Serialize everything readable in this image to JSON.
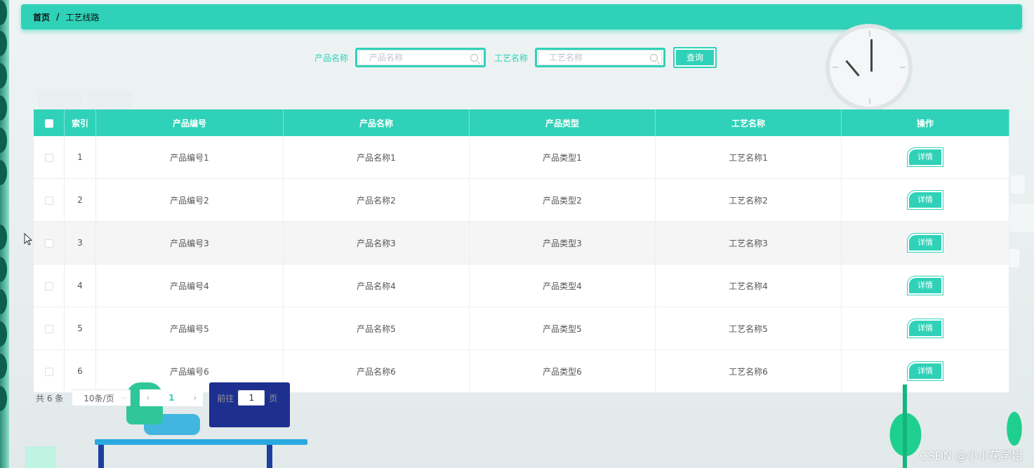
{
  "breadcrumb": {
    "home": "首页",
    "separator": "/",
    "current": "工艺线路"
  },
  "search": {
    "product_name_label": "产品名称",
    "product_name_placeholder": "产品名称",
    "process_name_label": "工艺名称",
    "process_name_placeholder": "工艺名称",
    "query_button": "查询"
  },
  "table": {
    "columns": [
      "索引",
      "产品编号",
      "产品名称",
      "产品类型",
      "工艺名称",
      "操作"
    ],
    "rows": [
      {
        "index": "1",
        "product_no": "产品编号1",
        "product_name": "产品名称1",
        "product_type": "产品类型1",
        "process_name": "工艺名称1",
        "action": "详情"
      },
      {
        "index": "2",
        "product_no": "产品编号2",
        "product_name": "产品名称2",
        "product_type": "产品类型2",
        "process_name": "工艺名称2",
        "action": "详情"
      },
      {
        "index": "3",
        "product_no": "产品编号3",
        "product_name": "产品名称3",
        "product_type": "产品类型3",
        "process_name": "工艺名称3",
        "action": "详情"
      },
      {
        "index": "4",
        "product_no": "产品编号4",
        "product_name": "产品名称4",
        "product_type": "产品类型4",
        "process_name": "工艺名称4",
        "action": "详情"
      },
      {
        "index": "5",
        "product_no": "产品编号5",
        "product_name": "产品名称5",
        "product_type": "产品类型5",
        "process_name": "工艺名称5",
        "action": "详情"
      },
      {
        "index": "6",
        "product_no": "产品编号6",
        "product_name": "产品名称6",
        "product_type": "产品类型6",
        "process_name": "工艺名称6",
        "action": "详情"
      }
    ]
  },
  "pagination": {
    "total": "共 6 条",
    "page_size": "10条/页",
    "current_page": "1",
    "goto_prefix": "前往",
    "goto_value": "1",
    "goto_suffix": "页"
  },
  "watermark": "CSDN @小小花学姐",
  "colors": {
    "accent": "#2fd2b8",
    "background": "#eef3f4"
  },
  "icons": [
    "search-icon",
    "chevron-left-icon",
    "chevron-right-icon",
    "chevron-down-icon",
    "mouse-cursor-icon"
  ]
}
